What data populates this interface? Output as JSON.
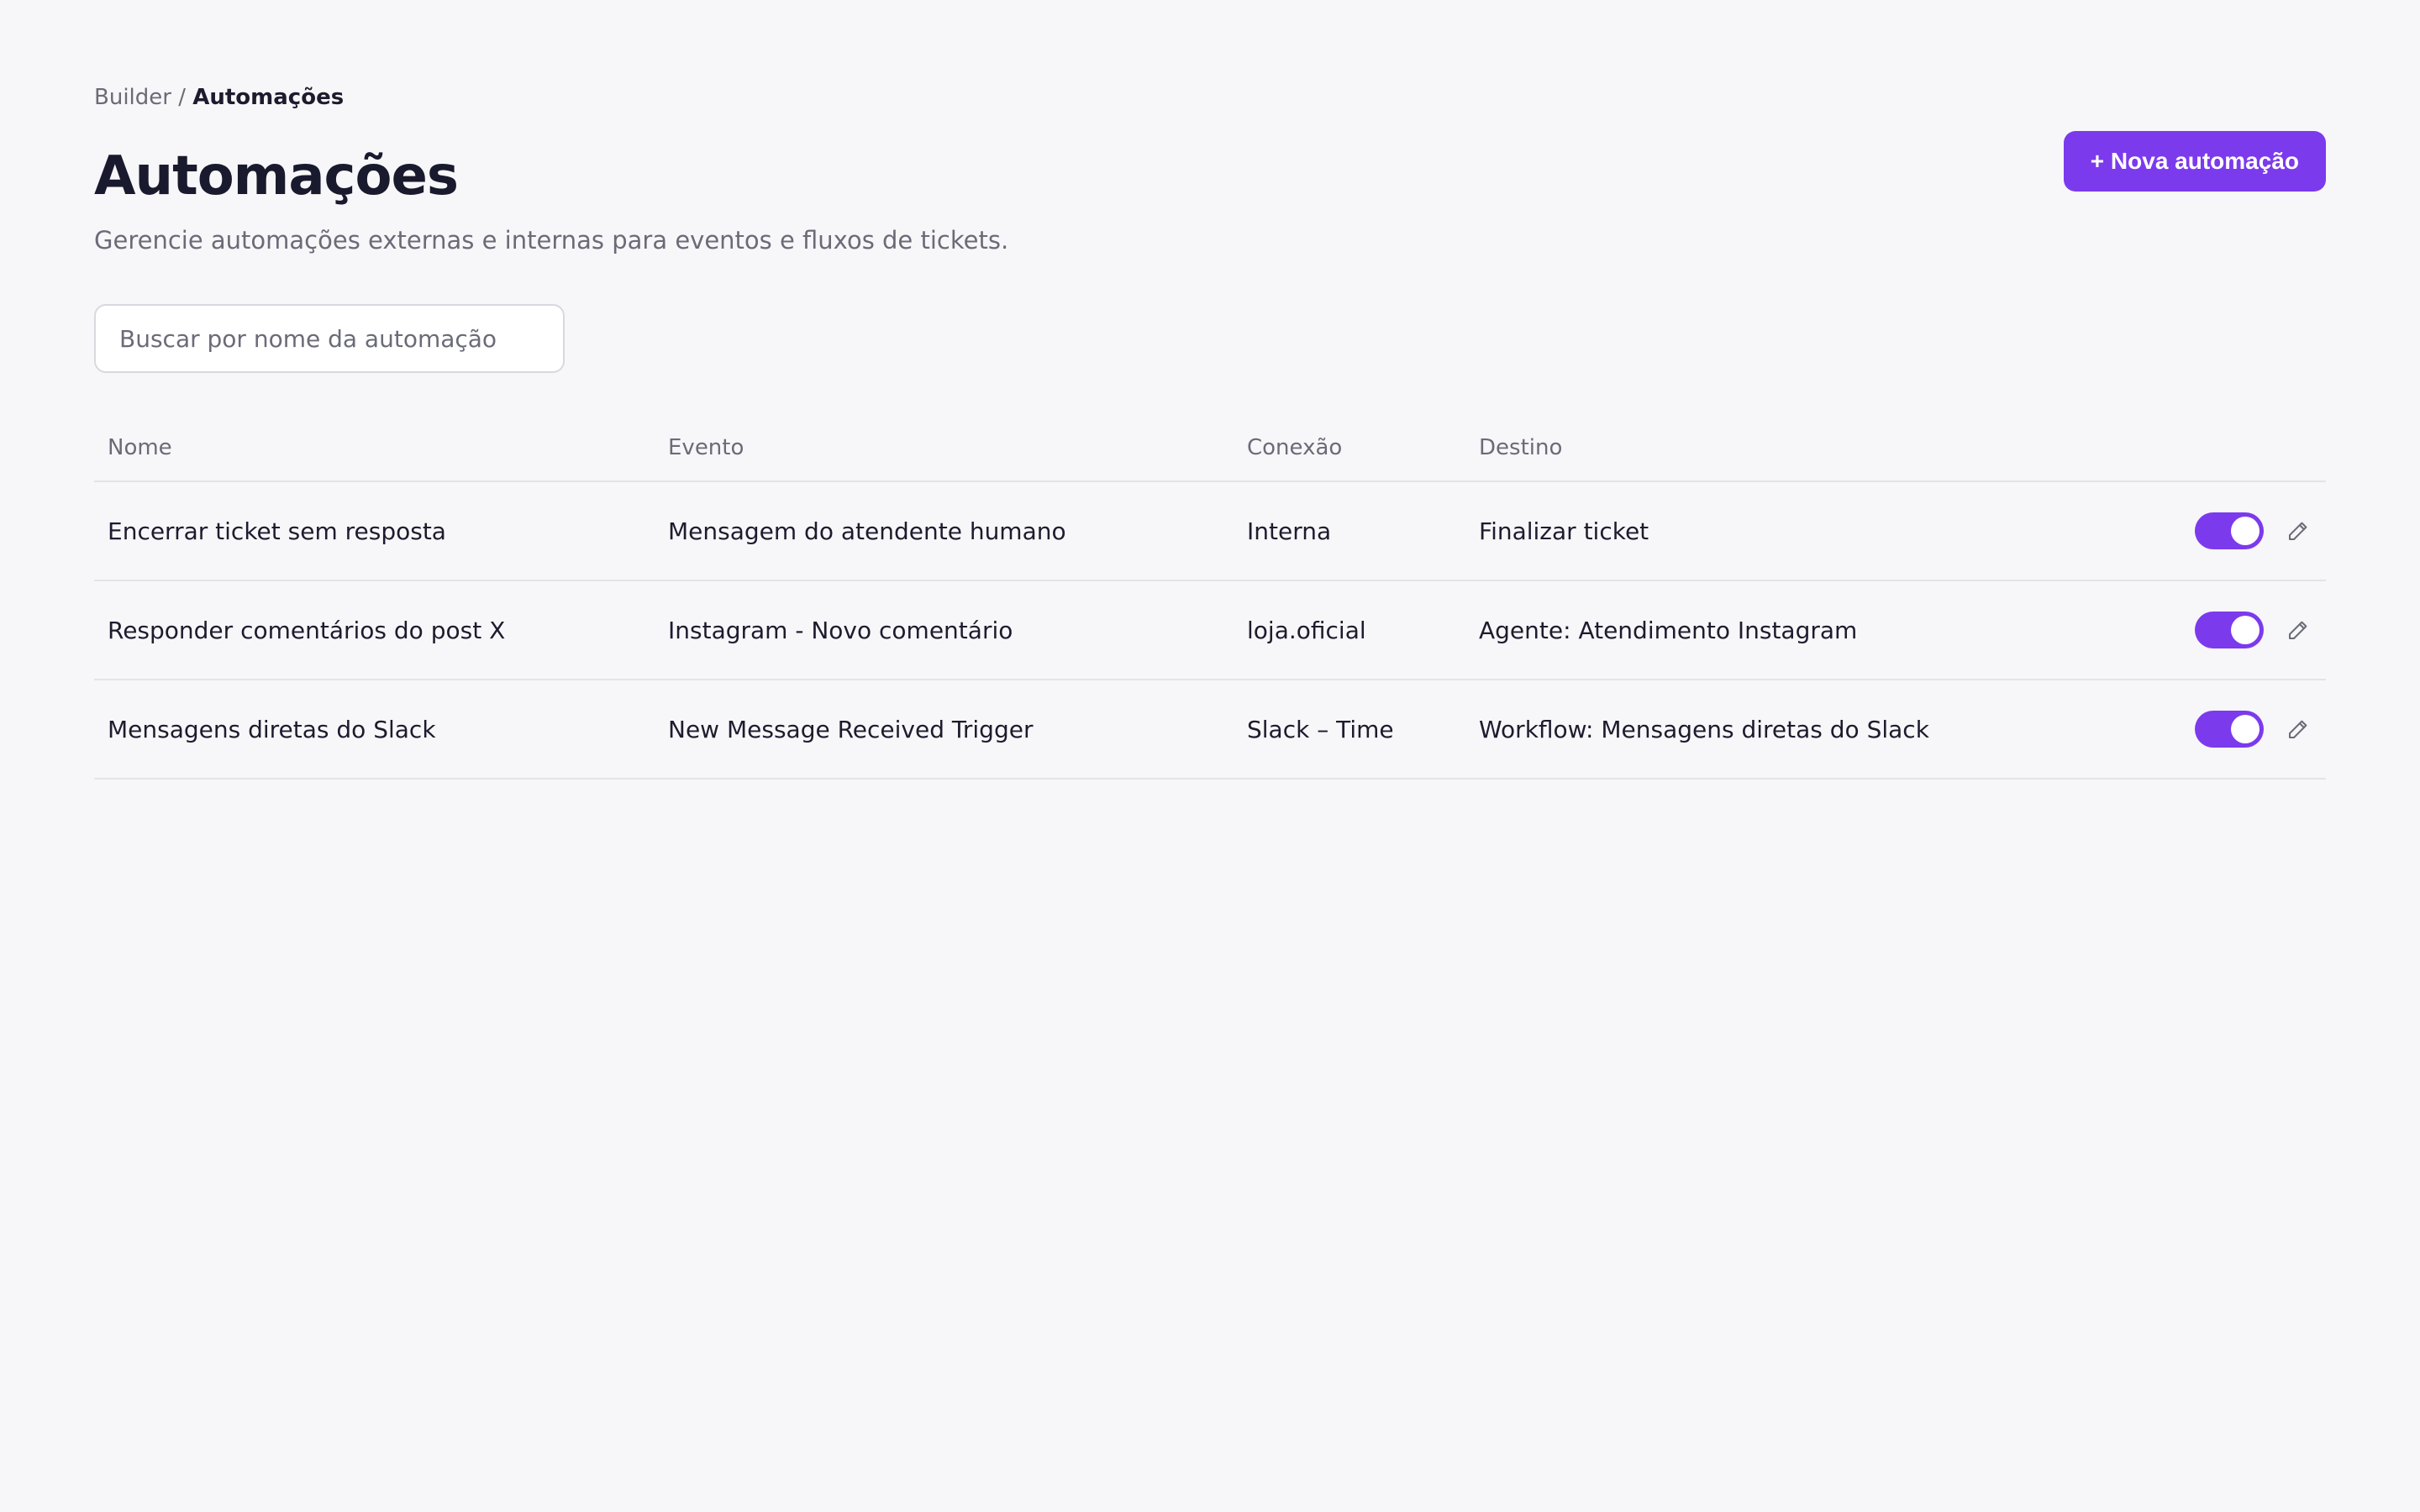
{
  "breadcrumb": {
    "parent": "Builder",
    "separator": " / ",
    "current": "Automações"
  },
  "header": {
    "title": "Automações",
    "subtitle": "Gerencie automações externas e internas para eventos e fluxos de tickets.",
    "new_button_label": "+ Nova automação"
  },
  "search": {
    "placeholder": "Buscar por nome da automação",
    "value": ""
  },
  "table": {
    "columns": [
      "Nome",
      "Evento",
      "Conexão",
      "Destino"
    ],
    "rows": [
      {
        "nome": "Encerrar ticket sem resposta",
        "evento": "Mensagem do atendente humano",
        "conexao": "Interna",
        "destino": "Finalizar ticket",
        "enabled": true
      },
      {
        "nome": "Responder comentários do post X",
        "evento": "Instagram - Novo comentário",
        "conexao": "loja.oficial",
        "destino": "Agente: Atendimento Instagram",
        "enabled": true
      },
      {
        "nome": "Mensagens diretas do Slack",
        "evento": "New Message Received Trigger",
        "conexao": "Slack – Time",
        "destino": "Workflow: Mensagens diretas do Slack",
        "enabled": true
      }
    ]
  },
  "icons": {
    "edit": "pencil-icon"
  },
  "colors": {
    "accent": "#7c3aed",
    "background": "#f7f7f9",
    "text_primary": "#1e1b2e",
    "text_muted": "#6b6b78"
  }
}
